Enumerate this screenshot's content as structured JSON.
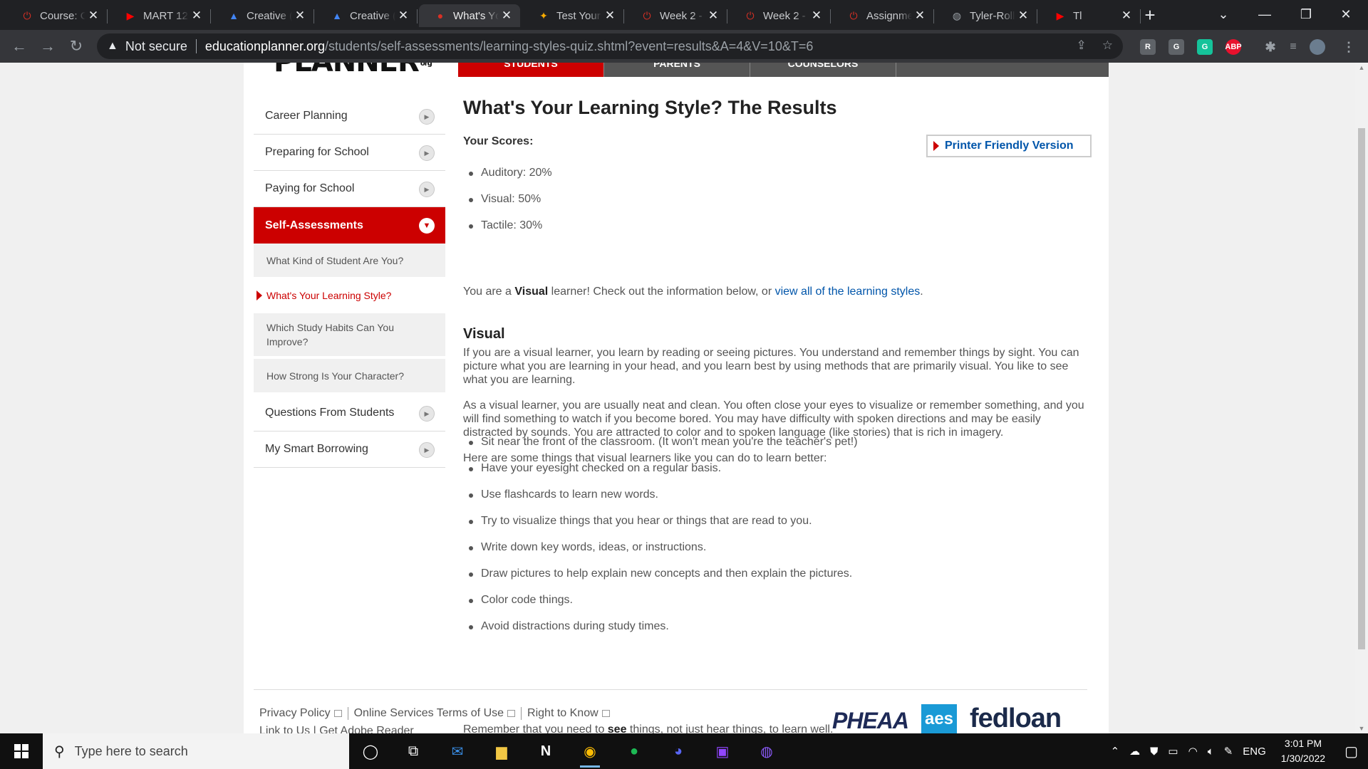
{
  "browser": {
    "tabs": [
      {
        "label": "Course: C",
        "icon": "power-icon",
        "color": "#d93025"
      },
      {
        "label": "MART 12(",
        "icon": "youtube-icon",
        "color": "#ff0000"
      },
      {
        "label": "Creative (",
        "icon": "drive-icon",
        "color": "#4285f4"
      },
      {
        "label": "Creative (",
        "icon": "drive-icon",
        "color": "#4285f4"
      },
      {
        "label": "What's Yc",
        "icon": "apple-icon",
        "color": "#d93025",
        "active": true
      },
      {
        "label": "Test Your",
        "icon": "lightbulb-icon",
        "color": "#f9ab00"
      },
      {
        "label": "Week 2 -",
        "icon": "power-icon",
        "color": "#d93025"
      },
      {
        "label": "Week 2 -",
        "icon": "power-icon",
        "color": "#d93025"
      },
      {
        "label": "Assignme",
        "icon": "power-icon",
        "color": "#d93025"
      },
      {
        "label": "Tyler-Roll",
        "icon": "github-icon",
        "color": "#9aa0a6"
      },
      {
        "label": "Tl",
        "icon": "youtube-icon",
        "color": "#ff0000"
      }
    ],
    "address": {
      "security_label": "Not secure",
      "host": "educationplanner.org",
      "path": "/students/self-assessments/learning-styles-quiz.shtml?event=results&A=4&V=10&T=6"
    },
    "extensions": [
      {
        "label": "R",
        "color": "#5f6368"
      },
      {
        "label": "G",
        "color": "#5f6368"
      },
      {
        "label": "G",
        "color": "#15c39a"
      },
      {
        "label": "ABP",
        "color": "#e8112d"
      }
    ]
  },
  "site": {
    "logo_text": "PLANNER",
    "logo_suffix": "org",
    "topnav": [
      "STUDENTS",
      "PARENTS",
      "COUNSELORS"
    ],
    "sidebar": {
      "items": [
        {
          "label": "Career Planning"
        },
        {
          "label": "Preparing for School"
        },
        {
          "label": "Paying for School"
        },
        {
          "label": "Self-Assessments",
          "active": true
        }
      ],
      "subitems": [
        {
          "label": "What Kind of Student Are You?"
        },
        {
          "label": "What's Your Learning Style?",
          "current": true
        },
        {
          "label": "Which Study Habits Can You Improve?"
        },
        {
          "label": "How Strong Is Your Character?"
        }
      ],
      "items_after": [
        {
          "label": "Questions From Students"
        },
        {
          "label": "My Smart Borrowing"
        }
      ]
    },
    "main": {
      "title": "What's Your Learning Style? The Results",
      "scores_heading": "Your Scores:",
      "printer_label": "Printer Friendly Version",
      "scores": [
        {
          "label": "Auditory",
          "value": "20%"
        },
        {
          "label": "Visual",
          "value": "50%"
        },
        {
          "label": "Tactile",
          "value": "30%"
        }
      ],
      "result_prefix": "You are a ",
      "result_style": "Visual",
      "result_middle": " learner! Check out the information below, or ",
      "result_link": "view all of the learning styles",
      "result_suffix": ".",
      "section_heading": "Visual",
      "para1": "If you are a visual learner, you learn by reading or seeing pictures. You understand and remember things by sight. You can picture what you are learning in your head, and you learn best by using methods that are primarily visual. You like to see what you are learning.",
      "para2": "As a visual learner, you are usually neat and clean. You often close your eyes to visualize or remember something, and you will find something to watch if you become bored. You may have difficulty with spoken directions and may be easily distracted by sounds. You are attracted to color and to spoken language (like stories) that is rich in imagery.",
      "para3": "Here are some things that visual learners like you can do to learn better:",
      "tips": [
        "Sit near the front of the classroom. (It won't mean you're the teacher's pet!)",
        "Have your eyesight checked on a regular basis.",
        "Use flashcards to learn new words.",
        "Try to visualize things that you hear or things that are read to you.",
        "Write down key words, ideas, or instructions.",
        "Draw pictures to help explain new concepts and then explain the pictures.",
        "Color code things.",
        "Avoid distractions during study times."
      ],
      "closing_prefix": "Remember that you need to ",
      "closing_bold": "see",
      "closing_suffix": " things, not just hear things, to learn well."
    },
    "footer": {
      "links": [
        "Privacy Policy",
        "Online Services Terms of Use",
        "Right to Know"
      ],
      "links_row2": "Link to Us | Get Adobe Reader",
      "partners": [
        "PHEAA",
        "aes",
        "fedloan"
      ]
    }
  },
  "taskbar": {
    "search_placeholder": "Type here to search",
    "language": "ENG",
    "time": "3:01 PM",
    "date": "1/30/2022"
  }
}
